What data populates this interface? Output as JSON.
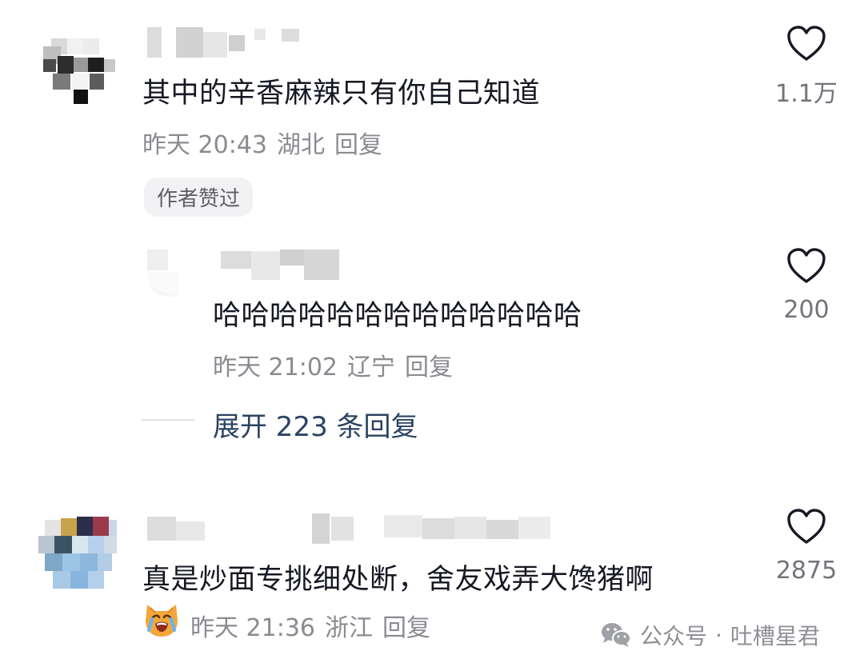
{
  "comments": [
    {
      "text": "其中的辛香麻辣只有你自己知道",
      "time": "昨天 20:43",
      "location": "湖北",
      "reply_label": "回复",
      "likes": "1.1万",
      "badge": "作者赞过"
    },
    {
      "text": "哈哈哈哈哈哈哈哈哈哈哈哈哈",
      "time": "昨天 21:02",
      "location": "辽宁",
      "reply_label": "回复",
      "likes": "200"
    },
    {
      "text": "真是炒面专挑细处断，舍友戏弄大馋猪啊",
      "time": "昨天 21:36",
      "location": "浙江",
      "reply_label": "回复",
      "likes": "2875"
    }
  ],
  "expand_replies": "展开 223 条回复",
  "watermark": {
    "prefix": "公众号",
    "separator": "·",
    "name": "吐槽星君"
  },
  "icons": {
    "like": "heart-outline-icon",
    "emoji": "crying-cat-emoji-icon",
    "watermark": "wechat-icon"
  },
  "colors": {
    "text": "#161823",
    "meta": "#8a8b91",
    "link": "#2b4361",
    "badge_bg": "#f2f2f4"
  }
}
